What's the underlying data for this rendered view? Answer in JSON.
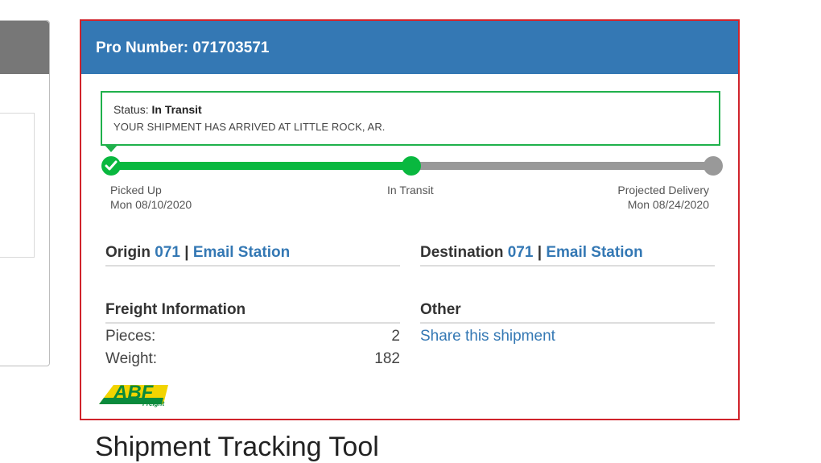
{
  "card": {
    "title": "Pro Number: 071703571",
    "border_color": "#d0232b",
    "header_color": "#3478b4"
  },
  "status": {
    "label": "Status:",
    "value": "In Transit",
    "message": "YOUR SHIPMENT HAS ARRIVED AT LITTLE ROCK, AR."
  },
  "progress": {
    "fraction_complete": 0.5,
    "complete_color": "#09b83f",
    "pending_color": "#999999",
    "stops": [
      {
        "label": "Picked Up",
        "date": "Mon 08/10/2020"
      },
      {
        "label": "In Transit",
        "date": ""
      },
      {
        "label": "Projected Delivery",
        "date": "Mon 08/24/2020"
      }
    ]
  },
  "origin": {
    "label": "Origin",
    "code": "071",
    "sep": "|",
    "email_link": "Email Station"
  },
  "destination": {
    "label": "Destination",
    "code": "071",
    "sep": "|",
    "email_link": "Email Station"
  },
  "freight": {
    "title": "Freight Information",
    "rows": [
      {
        "label": "Pieces:",
        "value": "2"
      },
      {
        "label": "Weight:",
        "value": "182"
      }
    ]
  },
  "other": {
    "title": "Other",
    "share_link": "Share this shipment"
  },
  "logo": {
    "text": "ABF",
    "subtext": "Freight"
  },
  "below": {
    "text": "Shipment Tracking Tool"
  }
}
